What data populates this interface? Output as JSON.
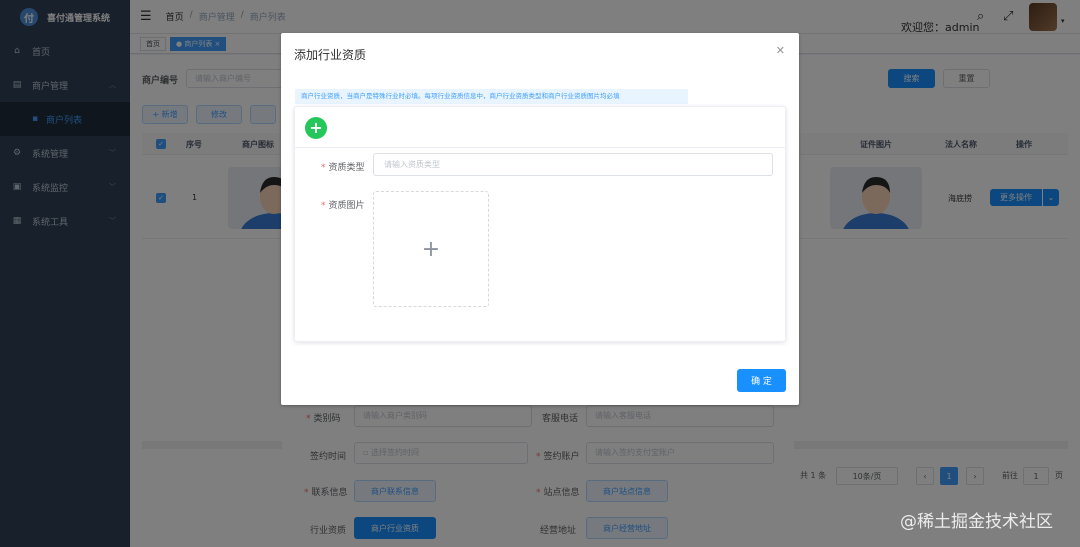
{
  "app": {
    "title": "喜付通管理系统",
    "logo_letter": "付"
  },
  "sidebar": {
    "items": [
      {
        "label": "首页",
        "icon": "dashboard-icon"
      },
      {
        "label": "商户管理",
        "icon": "shop-icon"
      },
      {
        "label": "商户列表",
        "icon": "list-icon"
      },
      {
        "label": "系统管理",
        "icon": "gear-icon"
      },
      {
        "label": "系统监控",
        "icon": "monitor-icon"
      },
      {
        "label": "系统工具",
        "icon": "tool-icon"
      }
    ]
  },
  "header": {
    "breadcrumb": [
      "首页",
      "商户管理",
      "商户列表"
    ],
    "welcome": "欢迎您：admin"
  },
  "tags": {
    "home": "首页",
    "active": "● 商户列表 ×"
  },
  "search": {
    "label": "商户编号",
    "placeholder": "请输入商户编号",
    "search_button": "搜索",
    "reset_button": "重置"
  },
  "toolbar": {
    "add": "+ 新增",
    "edit": "修改"
  },
  "table": {
    "headers": [
      "序号",
      "商户图标",
      "证件图片",
      "法人名称",
      "操作"
    ],
    "rows": [
      {
        "index": "1",
        "legal_name": "海底捞",
        "action": "更多操作"
      }
    ]
  },
  "pagination": {
    "total": "共 1 条",
    "page_size": "10条/页",
    "current": "1",
    "goto_label": "前往",
    "goto_value": "1",
    "page_unit": "页"
  },
  "form": {
    "category_code": {
      "label": "类别码",
      "placeholder": "请输入商户类别码"
    },
    "service_phone": {
      "label": "客服电话",
      "placeholder": "请输入客服电话"
    },
    "sign_time": {
      "label": "签约时间",
      "placeholder": "选择签约时间"
    },
    "sign_account": {
      "label": "签约账户",
      "placeholder": "请输入签约支付宝账户"
    },
    "contact": {
      "label": "联系信息",
      "button": "商户联系信息"
    },
    "site": {
      "label": "站点信息",
      "button": "商户站点信息"
    },
    "qualification": {
      "label": "行业资质",
      "button": "商户行业资质"
    },
    "address": {
      "label": "经营地址",
      "button": "商户经营地址"
    }
  },
  "modal": {
    "title": "添加行业资质",
    "tip": "商户行业资质，当商户是特殊行业时必填。每项行业资质信息中，商户行业资质类型和商户行业资质图片均必填",
    "type_label": "资质类型",
    "type_placeholder": "请输入资质类型",
    "image_label": "资质图片",
    "confirm_button": "确 定"
  },
  "watermark": "@稀土掘金技术社区",
  "colors": {
    "sidebar_bg": "#304156",
    "primary": "#1890ff",
    "success": "#24c75a"
  }
}
